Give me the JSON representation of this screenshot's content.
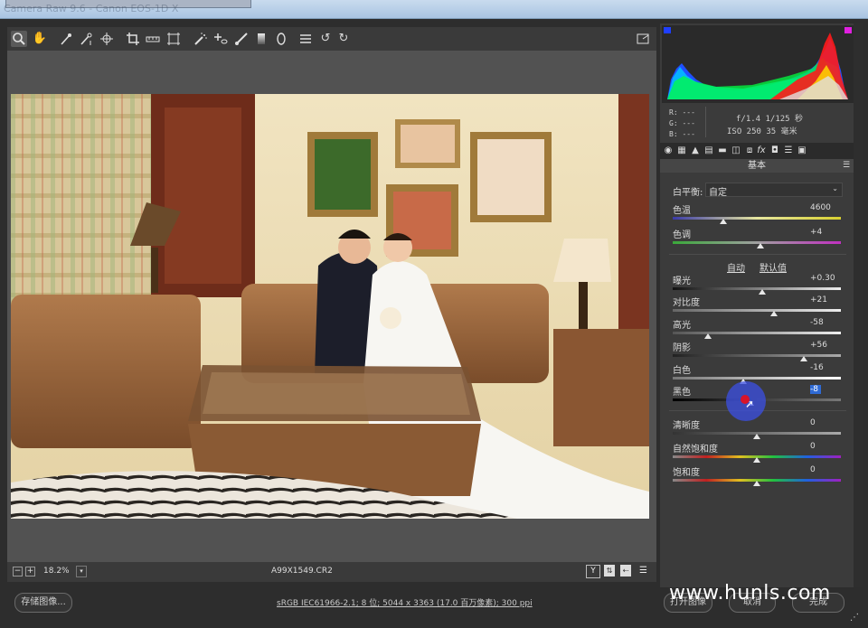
{
  "window": {
    "title": "Camera Raw 9.6 - Canon EOS-1D X"
  },
  "toolbar": {
    "tools": [
      "zoom-icon",
      "hand-icon",
      "white-balance-icon",
      "color-sampler-icon",
      "target-adjustment-icon",
      "crop-icon",
      "straighten-icon",
      "transform-icon",
      "spot-removal-icon",
      "red-eye-icon",
      "adjustment-brush-icon",
      "graduated-filter-icon",
      "radial-filter-icon",
      "preferences-icon",
      "rotate-left-icon",
      "rotate-right-icon"
    ],
    "fullscreen_icon": "fullscreen-icon"
  },
  "status": {
    "zoom": "18.2%",
    "filename": "A99X1549.CR2"
  },
  "bottom": {
    "save_label": "存储图像...",
    "workflow": "sRGB IEC61966-2.1; 8 位; 5044 x 3363 (17.0 百万像素); 300 ppi",
    "open_label": "打开图像",
    "cancel_label": "取消",
    "done_label": "完成",
    "watermark": "www.hunls.com"
  },
  "readout": {
    "r": "R:  ---",
    "g": "G:  ---",
    "b": "B:  ---",
    "line1": "f/1.4  1/125 秒",
    "line2": "ISO 250  35 毫米"
  },
  "panel": {
    "section_title": "基本",
    "wb_label": "白平衡:",
    "wb_value": "自定",
    "auto": "自动",
    "default": "默认值",
    "sliders": [
      {
        "label": "色温",
        "value": "4600",
        "pos": 0.3
      },
      {
        "label": "色调",
        "value": "+4",
        "pos": 0.52
      },
      {
        "label": "曝光",
        "value": "+0.30",
        "pos": 0.53
      },
      {
        "label": "对比度",
        "value": "+21",
        "pos": 0.6
      },
      {
        "label": "高光",
        "value": "-58",
        "pos": 0.21
      },
      {
        "label": "阴影",
        "value": "+56",
        "pos": 0.78
      },
      {
        "label": "白色",
        "value": "-16",
        "pos": 0.42
      },
      {
        "label": "黑色",
        "value": "-8",
        "pos": 0.46
      },
      {
        "label": "清晰度",
        "value": "0",
        "pos": 0.5
      },
      {
        "label": "自然饱和度",
        "value": "0",
        "pos": 0.5
      },
      {
        "label": "饱和度",
        "value": "0",
        "pos": 0.5
      }
    ]
  },
  "colors": {
    "accent": "#3a6ec8",
    "panel": "#3b3b3b",
    "canvas": "#525252"
  }
}
